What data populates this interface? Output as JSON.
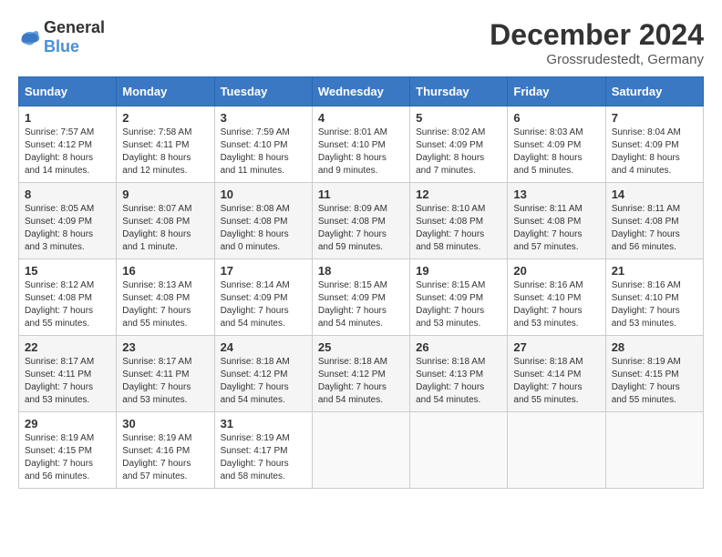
{
  "header": {
    "logo": {
      "general": "General",
      "blue": "Blue"
    },
    "title": "December 2024",
    "location": "Grossrudestedt, Germany"
  },
  "calendar": {
    "weekdays": [
      "Sunday",
      "Monday",
      "Tuesday",
      "Wednesday",
      "Thursday",
      "Friday",
      "Saturday"
    ],
    "weeks": [
      [
        {
          "day": "1",
          "sunrise": "7:57 AM",
          "sunset": "4:12 PM",
          "daylight": "8 hours and 14 minutes."
        },
        {
          "day": "2",
          "sunrise": "7:58 AM",
          "sunset": "4:11 PM",
          "daylight": "8 hours and 12 minutes."
        },
        {
          "day": "3",
          "sunrise": "7:59 AM",
          "sunset": "4:10 PM",
          "daylight": "8 hours and 11 minutes."
        },
        {
          "day": "4",
          "sunrise": "8:01 AM",
          "sunset": "4:10 PM",
          "daylight": "8 hours and 9 minutes."
        },
        {
          "day": "5",
          "sunrise": "8:02 AM",
          "sunset": "4:09 PM",
          "daylight": "8 hours and 7 minutes."
        },
        {
          "day": "6",
          "sunrise": "8:03 AM",
          "sunset": "4:09 PM",
          "daylight": "8 hours and 5 minutes."
        },
        {
          "day": "7",
          "sunrise": "8:04 AM",
          "sunset": "4:09 PM",
          "daylight": "8 hours and 4 minutes."
        }
      ],
      [
        {
          "day": "8",
          "sunrise": "8:05 AM",
          "sunset": "4:09 PM",
          "daylight": "8 hours and 3 minutes."
        },
        {
          "day": "9",
          "sunrise": "8:07 AM",
          "sunset": "4:08 PM",
          "daylight": "8 hours and 1 minute."
        },
        {
          "day": "10",
          "sunrise": "8:08 AM",
          "sunset": "4:08 PM",
          "daylight": "8 hours and 0 minutes."
        },
        {
          "day": "11",
          "sunrise": "8:09 AM",
          "sunset": "4:08 PM",
          "daylight": "7 hours and 59 minutes."
        },
        {
          "day": "12",
          "sunrise": "8:10 AM",
          "sunset": "4:08 PM",
          "daylight": "7 hours and 58 minutes."
        },
        {
          "day": "13",
          "sunrise": "8:11 AM",
          "sunset": "4:08 PM",
          "daylight": "7 hours and 57 minutes."
        },
        {
          "day": "14",
          "sunrise": "8:11 AM",
          "sunset": "4:08 PM",
          "daylight": "7 hours and 56 minutes."
        }
      ],
      [
        {
          "day": "15",
          "sunrise": "8:12 AM",
          "sunset": "4:08 PM",
          "daylight": "7 hours and 55 minutes."
        },
        {
          "day": "16",
          "sunrise": "8:13 AM",
          "sunset": "4:08 PM",
          "daylight": "7 hours and 55 minutes."
        },
        {
          "day": "17",
          "sunrise": "8:14 AM",
          "sunset": "4:09 PM",
          "daylight": "7 hours and 54 minutes."
        },
        {
          "day": "18",
          "sunrise": "8:15 AM",
          "sunset": "4:09 PM",
          "daylight": "7 hours and 54 minutes."
        },
        {
          "day": "19",
          "sunrise": "8:15 AM",
          "sunset": "4:09 PM",
          "daylight": "7 hours and 53 minutes."
        },
        {
          "day": "20",
          "sunrise": "8:16 AM",
          "sunset": "4:10 PM",
          "daylight": "7 hours and 53 minutes."
        },
        {
          "day": "21",
          "sunrise": "8:16 AM",
          "sunset": "4:10 PM",
          "daylight": "7 hours and 53 minutes."
        }
      ],
      [
        {
          "day": "22",
          "sunrise": "8:17 AM",
          "sunset": "4:11 PM",
          "daylight": "7 hours and 53 minutes."
        },
        {
          "day": "23",
          "sunrise": "8:17 AM",
          "sunset": "4:11 PM",
          "daylight": "7 hours and 53 minutes."
        },
        {
          "day": "24",
          "sunrise": "8:18 AM",
          "sunset": "4:12 PM",
          "daylight": "7 hours and 54 minutes."
        },
        {
          "day": "25",
          "sunrise": "8:18 AM",
          "sunset": "4:12 PM",
          "daylight": "7 hours and 54 minutes."
        },
        {
          "day": "26",
          "sunrise": "8:18 AM",
          "sunset": "4:13 PM",
          "daylight": "7 hours and 54 minutes."
        },
        {
          "day": "27",
          "sunrise": "8:18 AM",
          "sunset": "4:14 PM",
          "daylight": "7 hours and 55 minutes."
        },
        {
          "day": "28",
          "sunrise": "8:19 AM",
          "sunset": "4:15 PM",
          "daylight": "7 hours and 55 minutes."
        }
      ],
      [
        {
          "day": "29",
          "sunrise": "8:19 AM",
          "sunset": "4:15 PM",
          "daylight": "7 hours and 56 minutes."
        },
        {
          "day": "30",
          "sunrise": "8:19 AM",
          "sunset": "4:16 PM",
          "daylight": "7 hours and 57 minutes."
        },
        {
          "day": "31",
          "sunrise": "8:19 AM",
          "sunset": "4:17 PM",
          "daylight": "7 hours and 58 minutes."
        },
        null,
        null,
        null,
        null
      ]
    ],
    "labels": {
      "sunrise": "Sunrise:",
      "sunset": "Sunset:",
      "daylight": "Daylight:"
    }
  }
}
